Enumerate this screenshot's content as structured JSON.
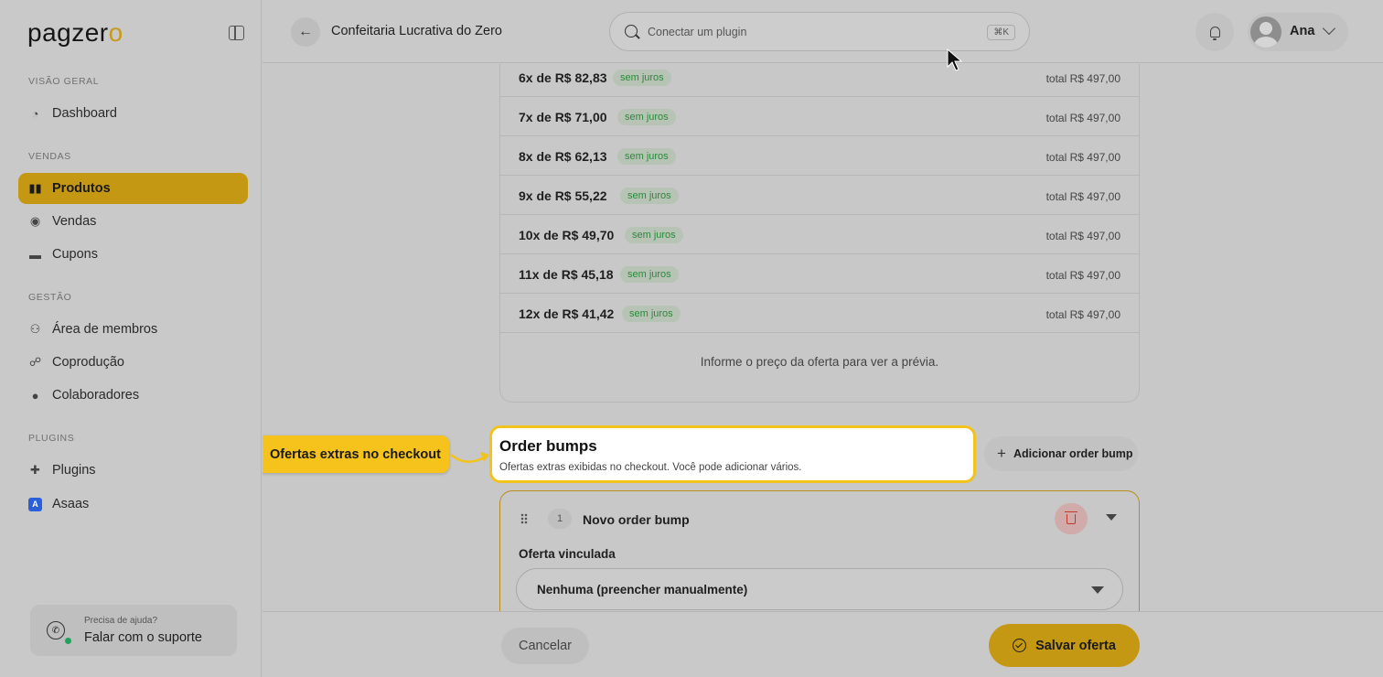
{
  "sidebar": {
    "logo": {
      "text": "pagzer",
      "accent": "o"
    },
    "sections": [
      {
        "label": "VISÃO GERAL"
      },
      {
        "label": "VENDAS"
      },
      {
        "label": "GESTÃO"
      },
      {
        "label": "PLUGINS"
      }
    ],
    "items": {
      "dashboard": "Dashboard",
      "produtos": "Produtos",
      "vendas": "Vendas",
      "cupons": "Cupons",
      "area_membros": "Área de membros",
      "coproducao": "Coprodução",
      "colaboradores": "Colaboradores",
      "plugins": "Plugins",
      "asaas": "Asaas"
    },
    "support": {
      "small": "Precisa de ajuda?",
      "big": "Falar com o suporte"
    }
  },
  "header": {
    "title": "Confeitaria Lucrativa do Zero",
    "search_placeholder": "Conectar um plugin",
    "search_shortcut": "⌘K",
    "user_name": "Ana"
  },
  "installments": [
    {
      "label": "6x de R$ 82,83",
      "badge": "sem juros",
      "total": "total R$ 497,00"
    },
    {
      "label": "7x de R$ 71,00",
      "badge": "sem juros",
      "total": "total R$ 497,00"
    },
    {
      "label": "8x de R$ 62,13",
      "badge": "sem juros",
      "total": "total R$ 497,00"
    },
    {
      "label": "9x de R$ 55,22",
      "badge": "sem juros",
      "total": "total R$ 497,00"
    },
    {
      "label": "10x de R$ 49,70",
      "badge": "sem juros",
      "total": "total R$ 497,00"
    },
    {
      "label": "11x de R$ 45,18",
      "badge": "sem juros",
      "total": "total R$ 497,00"
    },
    {
      "label": "12x de R$ 41,42",
      "badge": "sem juros",
      "total": "total R$ 497,00"
    }
  ],
  "preview_note": "Informe o preço da oferta para ver a prévia.",
  "callout": "Ofertas extras no checkout",
  "order_bumps": {
    "title": "Order bumps",
    "subtitle": "Ofertas extras exibidas no checkout. Você pode adicionar vários.",
    "add_label": "Adicionar order bump",
    "bump": {
      "number": "1",
      "title": "Novo order bump",
      "linked_label": "Oferta vinculada",
      "linked_value": "Nenhuma (preencher manualmente)"
    }
  },
  "footer": {
    "cancel": "Cancelar",
    "save": "Salvar oferta"
  },
  "colors": {
    "accent": "#c59813",
    "highlight": "#f6c21c",
    "badge_text": "#2a8a3a",
    "danger": "#c0392b"
  }
}
